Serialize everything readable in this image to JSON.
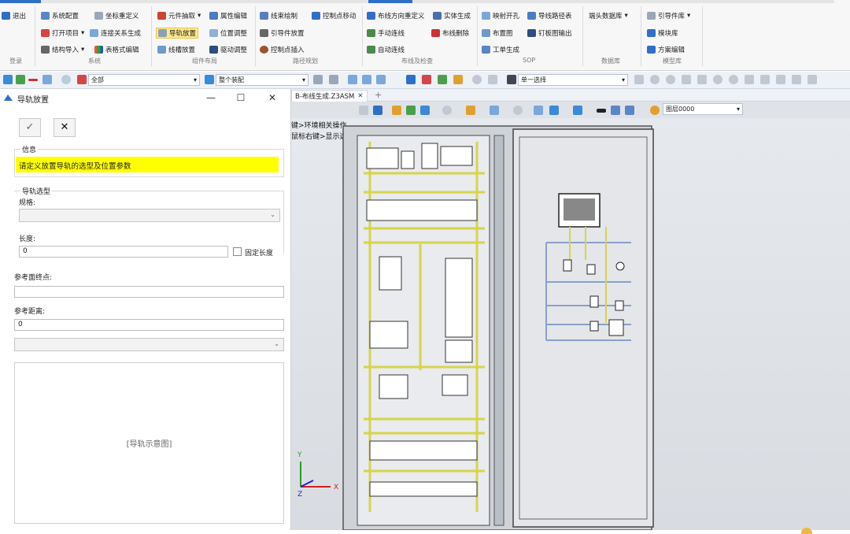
{
  "ribbon": {
    "groups": [
      {
        "label": "登录"
      },
      {
        "label": "系统"
      },
      {
        "label": "组件布局"
      },
      {
        "label": "路径规划"
      },
      {
        "label": "布线及检查"
      },
      {
        "label": "SOP"
      },
      {
        "label": "数据库"
      },
      {
        "label": "模型库"
      }
    ],
    "buttons": {
      "logout": "退出",
      "sys_config": "系统配置",
      "coord_redefine": "坐标重定义",
      "open_project": "打开项目",
      "conn_gen": "连接关系生成",
      "struct_import": "结构导入",
      "table_edit": "表格式编辑",
      "comp_extract": "元件抽取",
      "attr_edit": "属性编辑",
      "rail_place": "导轨放置",
      "pos_adjust": "位置调整",
      "duct_place": "线槽放置",
      "drive_adjust": "驱动调整",
      "harness_draw": "线束绘制",
      "ctrl_move": "控制点移动",
      "guide_place": "引导件放置",
      "ctrl_insert": "控制点插入",
      "dir_redefine": "布线方向重定义",
      "solid_gen": "实体生成",
      "manual_wire": "手动连线",
      "wire_delete": "布线删除",
      "auto_wire": "自动连线",
      "map_open": "映射开孔",
      "wire_path_table": "导线路径表",
      "layout_chart": "布置图",
      "nail_board_out": "钉板图输出",
      "work_order": "工单生成",
      "terminal_db": "端头数据库",
      "guide_lib": "引导件库",
      "module_lib": "模块库",
      "scheme_edit": "方案编辑"
    }
  },
  "toolbar": {
    "filter_value": "全部",
    "assembly_value": "整个装配",
    "select_mode": "单一选择",
    "layer": "图层0000"
  },
  "dialog": {
    "title": "导轨放置",
    "window_controls": {
      "minimize": "—",
      "maximize": "☐",
      "close": "✕"
    },
    "ok_label": "✓",
    "cancel_label": "✕",
    "info_legend": "信息",
    "info_message": "请定义放置导轨的选型及位置参数",
    "rail_type_legend": "导轨选型",
    "spec_label": "规格:",
    "spec_value": "",
    "length_label": "长度:",
    "length_value": "0",
    "fixed_length_label": "固定长度",
    "ref_face_label": "参考面终点:",
    "ref_face_value": "",
    "ref_dist_label": "参考距离:",
    "ref_dist_value": "0",
    "preview_label": "[导轨示意图]"
  },
  "document": {
    "tab_label": "B-布线生成.Z3ASM",
    "tab_close": "✕",
    "tab_add": "+",
    "hint_line1": "键>环境相关操作",
    "hint_line2": "鼠标右键>显示选择过滤器"
  },
  "colors": {
    "accent": "#2f6fc7",
    "info_bg": "#ffff00",
    "rail": "#d7d44a"
  }
}
